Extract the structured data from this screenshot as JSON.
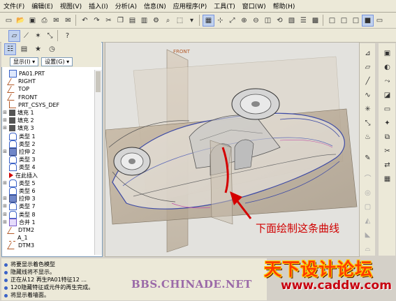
{
  "menu": [
    "文件(F)",
    "编辑(E)",
    "视图(V)",
    "插入(I)",
    "分析(A)",
    "信息(N)",
    "应用程序(P)",
    "工具(T)",
    "窗口(W)",
    "帮助(H)"
  ],
  "model_tree": {
    "show_label": "显示(I) ▾",
    "settings_label": "设置(G) ▾",
    "items": [
      {
        "label": "PA01.PRT",
        "icon": "part-icon",
        "expand": ""
      },
      {
        "label": "RIGHT",
        "icon": "datum-plane-icon",
        "expand": ""
      },
      {
        "label": "TOP",
        "icon": "datum-plane-icon",
        "expand": ""
      },
      {
        "label": "FRONT",
        "icon": "datum-plane-icon",
        "expand": ""
      },
      {
        "label": "PRT_CSYS_DEF",
        "icon": "csys-icon",
        "expand": ""
      },
      {
        "label": "填充 1",
        "icon": "fill-surface-icon",
        "expand": "+"
      },
      {
        "label": "填充 2",
        "icon": "fill-surface-icon",
        "expand": "+"
      },
      {
        "label": "填充 3",
        "icon": "fill-surface-icon",
        "expand": "+"
      },
      {
        "label": "类型 1",
        "icon": "style-surface-icon",
        "expand": ""
      },
      {
        "label": "类型 2",
        "icon": "style-surface-icon",
        "expand": ""
      },
      {
        "label": "拉伸 2",
        "icon": "extrude-icon",
        "expand": "+"
      },
      {
        "label": "类型 3",
        "icon": "style-surface-icon",
        "expand": ""
      },
      {
        "label": "类型 4",
        "icon": "style-surface-icon",
        "expand": ""
      },
      {
        "label": "在此插入",
        "icon": "insert-here-arrow-icon",
        "expand": ""
      },
      {
        "label": "类型 5",
        "icon": "style-surface-icon",
        "expand": "+"
      },
      {
        "label": "类型 6",
        "icon": "style-surface-icon",
        "expand": ""
      },
      {
        "label": "拉伸 3",
        "icon": "extrude-icon",
        "expand": "+"
      },
      {
        "label": "类型 7",
        "icon": "style-surface-icon",
        "expand": "+"
      },
      {
        "label": "类型 8",
        "icon": "style-surface-icon",
        "expand": "+"
      },
      {
        "label": "合并 1",
        "icon": "merge-icon",
        "expand": "+"
      },
      {
        "label": "DTM2",
        "icon": "datum-plane-icon",
        "expand": ""
      },
      {
        "label": "A_1",
        "icon": "axis-icon",
        "expand": ""
      },
      {
        "label": "DTM3",
        "icon": "datum-plane-icon",
        "expand": ""
      }
    ]
  },
  "viewport": {
    "datum_label": "FRONT",
    "annotation": "下面绘制这条曲线"
  },
  "messages": [
    "将要显示着色模型",
    "隐藏线将不显示。",
    "正在从12 再生PA01特征12 ...",
    "120隐藏特征或元件的再生完成。",
    "将显示着墙面。"
  ],
  "watermark": "BBS.CHINADE.NET",
  "logo": {
    "line1": "天下设计论坛",
    "line2": "www.caddw.com"
  },
  "colors": {
    "accent": "#3a62c7",
    "annotation": "#d00000",
    "curve": "#d40000"
  }
}
